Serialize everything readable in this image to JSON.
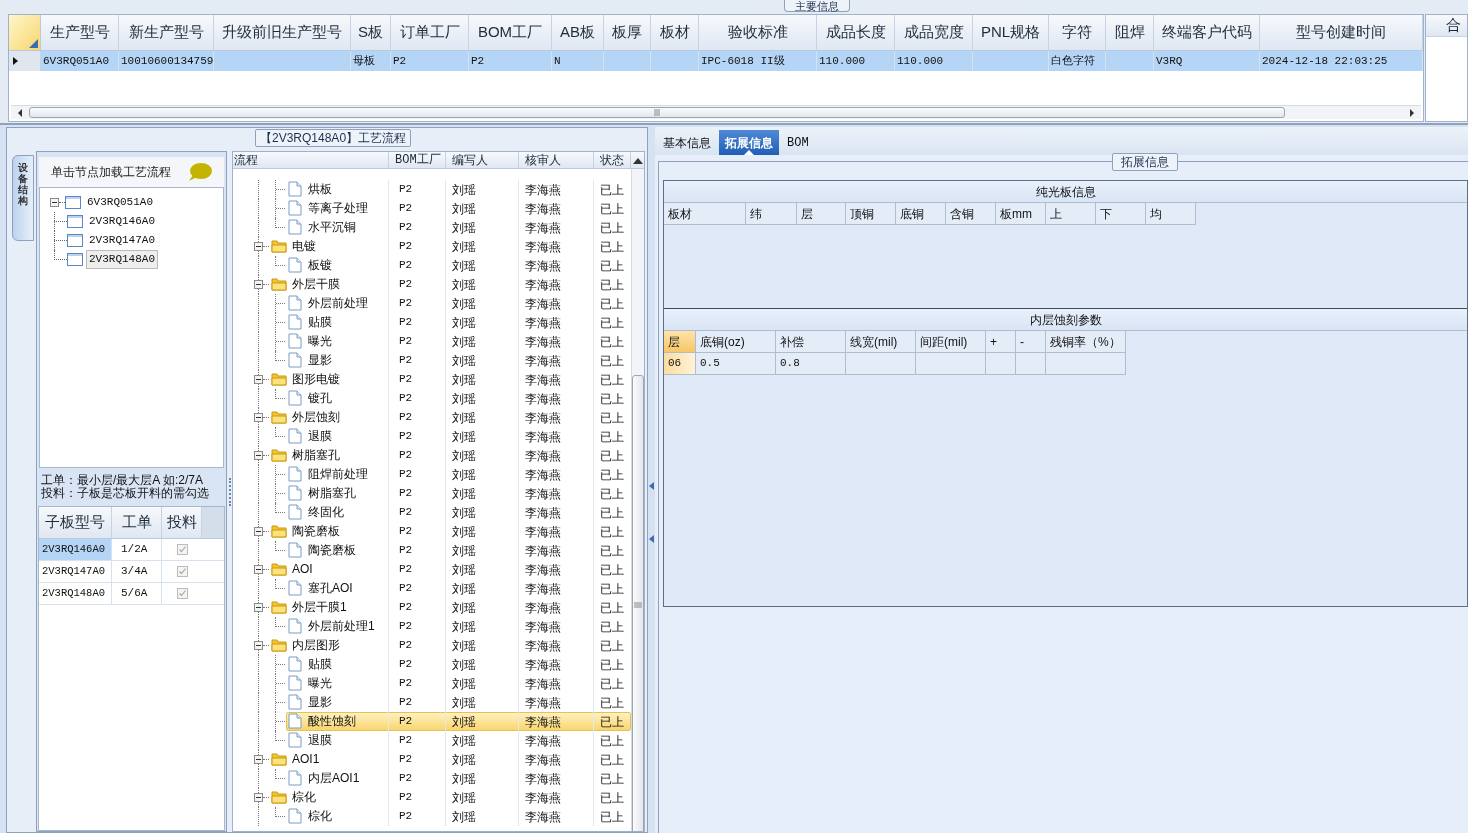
{
  "main_info": {
    "title": "主要信息",
    "columns": [
      "生产型号",
      "新生产型号",
      "升级前旧生产型号",
      "S板",
      "订单工厂",
      "BOM工厂",
      "AB板",
      "板厚",
      "板材",
      "验收标准",
      "成品长度",
      "成品宽度",
      "PNL规格",
      "字符",
      "阻焊",
      "终端客户代码",
      "型号创建时间"
    ],
    "rows": [
      {
        "selected": true,
        "cells": [
          "6V3RQ051A0",
          "10010600134759",
          null,
          "母板",
          "P2",
          "P2",
          "N",
          null,
          null,
          "IPC-6018 II级",
          "110.000",
          "110.000",
          null,
          "白色字符",
          null,
          "V3RQ",
          "2024-12-18 22:03:25"
        ]
      }
    ],
    "side_header": "合"
  },
  "process_panel": {
    "title": "【2V3RQ148A0】工艺流程",
    "side_tab": "设备结构",
    "tree_hint": "单击节点加载工艺流程",
    "tree": [
      {
        "label": "6V3RQ051A0",
        "expanded": true,
        "selected": false,
        "children": [
          {
            "label": "2V3RQ146A0",
            "selected": false
          },
          {
            "label": "2V3RQ147A0",
            "selected": false
          },
          {
            "label": "2V3RQ148A0",
            "selected": true
          }
        ]
      }
    ],
    "notes": [
      "工单：最小层/最大层A 如:2/7A",
      "投料：子板是芯板开料的需勾选"
    ],
    "sub_boards": {
      "columns": [
        "子板型号",
        "工单",
        "投料"
      ],
      "rows": [
        {
          "model": "2V3RQ146A0",
          "order": "1/2A",
          "feed": true,
          "selected": true
        },
        {
          "model": "2V3RQ147A0",
          "order": "3/4A",
          "feed": true,
          "selected": false
        },
        {
          "model": "2V3RQ148A0",
          "order": "5/6A",
          "feed": true,
          "selected": false
        }
      ]
    }
  },
  "flow": {
    "columns": [
      "流程",
      "BOM工厂",
      "编写人",
      "核审人",
      "状态"
    ],
    "rows": [
      {
        "kind": "step",
        "name": "烘板",
        "bom_factory": "P2",
        "writer": "刘瑶",
        "reviewer": "李海燕",
        "status": "已上",
        "selected": false
      },
      {
        "kind": "step",
        "name": "等离子处理",
        "bom_factory": "P2",
        "writer": "刘瑶",
        "reviewer": "李海燕",
        "status": "已上",
        "selected": false
      },
      {
        "kind": "step",
        "name": "水平沉铜",
        "bom_factory": "P2",
        "writer": "刘瑶",
        "reviewer": "李海燕",
        "status": "已上",
        "selected": false
      },
      {
        "kind": "folder",
        "name": "电镀",
        "bom_factory": "P2",
        "writer": "刘瑶",
        "reviewer": "李海燕",
        "status": "已上",
        "selected": false,
        "expanded": true,
        "children": [
          {
            "kind": "step",
            "name": "板镀",
            "bom_factory": "P2",
            "writer": "刘瑶",
            "reviewer": "李海燕",
            "status": "已上",
            "selected": false
          }
        ]
      },
      {
        "kind": "folder",
        "name": "外层干膜",
        "bom_factory": "P2",
        "writer": "刘瑶",
        "reviewer": "李海燕",
        "status": "已上",
        "selected": false,
        "expanded": true,
        "children": [
          {
            "kind": "step",
            "name": "外层前处理",
            "bom_factory": "P2",
            "writer": "刘瑶",
            "reviewer": "李海燕",
            "status": "已上",
            "selected": false
          },
          {
            "kind": "step",
            "name": "贴膜",
            "bom_factory": "P2",
            "writer": "刘瑶",
            "reviewer": "李海燕",
            "status": "已上",
            "selected": false
          },
          {
            "kind": "step",
            "name": "曝光",
            "bom_factory": "P2",
            "writer": "刘瑶",
            "reviewer": "李海燕",
            "status": "已上",
            "selected": false
          },
          {
            "kind": "step",
            "name": "显影",
            "bom_factory": "P2",
            "writer": "刘瑶",
            "reviewer": "李海燕",
            "status": "已上",
            "selected": false
          }
        ]
      },
      {
        "kind": "folder",
        "name": "图形电镀",
        "bom_factory": "P2",
        "writer": "刘瑶",
        "reviewer": "李海燕",
        "status": "已上",
        "selected": false,
        "expanded": true,
        "children": [
          {
            "kind": "step",
            "name": "镀孔",
            "bom_factory": "P2",
            "writer": "刘瑶",
            "reviewer": "李海燕",
            "status": "已上",
            "selected": false
          }
        ]
      },
      {
        "kind": "folder",
        "name": "外层蚀刻",
        "bom_factory": "P2",
        "writer": "刘瑶",
        "reviewer": "李海燕",
        "status": "已上",
        "selected": false,
        "expanded": true,
        "children": [
          {
            "kind": "step",
            "name": "退膜",
            "bom_factory": "P2",
            "writer": "刘瑶",
            "reviewer": "李海燕",
            "status": "已上",
            "selected": false
          }
        ]
      },
      {
        "kind": "folder",
        "name": "树脂塞孔",
        "bom_factory": "P2",
        "writer": "刘瑶",
        "reviewer": "李海燕",
        "status": "已上",
        "selected": false,
        "expanded": true,
        "children": [
          {
            "kind": "step",
            "name": "阻焊前处理",
            "bom_factory": "P2",
            "writer": "刘瑶",
            "reviewer": "李海燕",
            "status": "已上",
            "selected": false
          },
          {
            "kind": "step",
            "name": "树脂塞孔",
            "bom_factory": "P2",
            "writer": "刘瑶",
            "reviewer": "李海燕",
            "status": "已上",
            "selected": false
          },
          {
            "kind": "step",
            "name": "终固化",
            "bom_factory": "P2",
            "writer": "刘瑶",
            "reviewer": "李海燕",
            "status": "已上",
            "selected": false
          }
        ]
      },
      {
        "kind": "folder",
        "name": "陶瓷磨板",
        "bom_factory": "P2",
        "writer": "刘瑶",
        "reviewer": "李海燕",
        "status": "已上",
        "selected": false,
        "expanded": true,
        "children": [
          {
            "kind": "step",
            "name": "陶瓷磨板",
            "bom_factory": "P2",
            "writer": "刘瑶",
            "reviewer": "李海燕",
            "status": "已上",
            "selected": false
          }
        ]
      },
      {
        "kind": "folder",
        "name": "AOI",
        "bom_factory": "P2",
        "writer": "刘瑶",
        "reviewer": "李海燕",
        "status": "已上",
        "selected": false,
        "expanded": true,
        "children": [
          {
            "kind": "step",
            "name": "塞孔AOI",
            "bom_factory": "P2",
            "writer": "刘瑶",
            "reviewer": "李海燕",
            "status": "已上",
            "selected": false
          }
        ]
      },
      {
        "kind": "folder",
        "name": "外层干膜1",
        "bom_factory": "P2",
        "writer": "刘瑶",
        "reviewer": "李海燕",
        "status": "已上",
        "selected": false,
        "expanded": true,
        "children": [
          {
            "kind": "step",
            "name": "外层前处理1",
            "bom_factory": "P2",
            "writer": "刘瑶",
            "reviewer": "李海燕",
            "status": "已上",
            "selected": false
          }
        ]
      },
      {
        "kind": "folder",
        "name": "内层图形",
        "bom_factory": "P2",
        "writer": "刘瑶",
        "reviewer": "李海燕",
        "status": "已上",
        "selected": false,
        "expanded": true,
        "children": [
          {
            "kind": "step",
            "name": "贴膜",
            "bom_factory": "P2",
            "writer": "刘瑶",
            "reviewer": "李海燕",
            "status": "已上",
            "selected": false
          },
          {
            "kind": "step",
            "name": "曝光",
            "bom_factory": "P2",
            "writer": "刘瑶",
            "reviewer": "李海燕",
            "status": "已上",
            "selected": false
          },
          {
            "kind": "step",
            "name": "显影",
            "bom_factory": "P2",
            "writer": "刘瑶",
            "reviewer": "李海燕",
            "status": "已上",
            "selected": false
          },
          {
            "kind": "step",
            "name": "酸性蚀刻",
            "bom_factory": "P2",
            "writer": "刘瑶",
            "reviewer": "李海燕",
            "status": "已上",
            "selected": true
          },
          {
            "kind": "step",
            "name": "退膜",
            "bom_factory": "P2",
            "writer": "刘瑶",
            "reviewer": "李海燕",
            "status": "已上",
            "selected": false
          }
        ]
      },
      {
        "kind": "folder",
        "name": "AOI1",
        "bom_factory": "P2",
        "writer": "刘瑶",
        "reviewer": "李海燕",
        "status": "已上",
        "selected": false,
        "expanded": true,
        "children": [
          {
            "kind": "step",
            "name": "内层AOI1",
            "bom_factory": "P2",
            "writer": "刘瑶",
            "reviewer": "李海燕",
            "status": "已上",
            "selected": false
          }
        ]
      },
      {
        "kind": "folder",
        "name": "棕化",
        "bom_factory": "P2",
        "writer": "刘瑶",
        "reviewer": "李海燕",
        "status": "已上",
        "selected": false,
        "expanded": true,
        "children": [
          {
            "kind": "step",
            "name": "棕化",
            "bom_factory": "P2",
            "writer": "刘瑶",
            "reviewer": "李海燕",
            "status": "已上",
            "selected": false
          }
        ]
      }
    ]
  },
  "detail": {
    "tabs": [
      {
        "label": "基本信息",
        "selected": false
      },
      {
        "label": "拓展信息",
        "selected": true
      },
      {
        "label": "BOM",
        "selected": false
      }
    ],
    "group_title": "拓展信息",
    "sections": [
      {
        "title": "纯光板信息",
        "columns": [
          "板材",
          "纬",
          "层",
          "顶铜",
          "底铜",
          "含铜",
          "板mm",
          "上",
          "下",
          "均"
        ]
      },
      {
        "title": "内层蚀刻参数",
        "columns": [
          "层",
          "底铜(oz)",
          "补偿",
          "线宽(mil)",
          "间距(mil)",
          "+",
          "-",
          "残铜率（%）"
        ],
        "rows": [
          [
            "06",
            "0.5",
            "0.8",
            null,
            null,
            null,
            null,
            null
          ]
        ]
      }
    ]
  }
}
